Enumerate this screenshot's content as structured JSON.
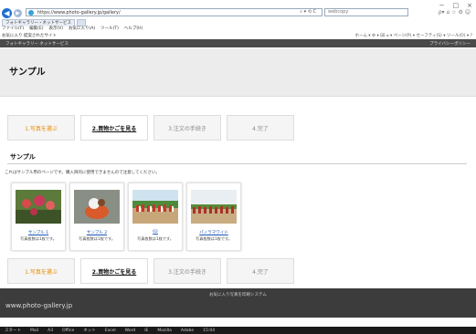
{
  "window": {
    "controls": [
      "−",
      "□",
      "×"
    ]
  },
  "browser": {
    "url": "https://www.photo-gallery.jp/gallery/",
    "url_tail": "⌕ ▾ ⟲ C",
    "search_placeholder": "webcopy",
    "right_icons": "ρ▾ ⌂ ☆ ⚙ ☺",
    "tab_label": "フォトギャラリー・ネットサービス",
    "menu": [
      "ファイル(F)",
      "編集(E)",
      "表示(V)",
      "お気に入り(A)",
      "ツール(T)",
      "ヘルプ(H)"
    ],
    "favorites_left": "お気に入り 提案されたサイト",
    "favorites_right": "ホーム ▾ ⚙ ▾ ⌧ ⌂ ▾ ページ(P) ▾ セーフティ(S) ▾ ツール(O) ▾ ?"
  },
  "site_header": {
    "left": "フォトギャラリー ネットサービス",
    "right": "プライバシーポリシー"
  },
  "page_title": "サンプル",
  "steps": [
    "1.写真を選ぶ",
    "2.買物かごを見る",
    "3.注文の手続き",
    "4.完了"
  ],
  "section_title": "サンプル",
  "note": "これはサンプル用のページです。購入目的に使用できませんので注意してください。",
  "gallery": [
    {
      "caption": "サンプル 1",
      "sub": "写真枚数は1枚です。",
      "scene": "flowers"
    },
    {
      "caption": "サンプル 2",
      "sub": "写真枚数は1枚です。",
      "scene": "dog"
    },
    {
      "caption": "02",
      "sub": "写真枚数は1枚です。",
      "scene": "crowd"
    },
    {
      "caption": "パノラマワイド",
      "sub": "写真枚数は1枚です。",
      "scene": "crowd2"
    }
  ],
  "footer": {
    "copyright": "お気に入り写真を印刷システム",
    "site": "www.photo-gallery.jp"
  },
  "taskbar": [
    "スタート",
    "Mail",
    "A3",
    "Office",
    "ネット",
    "Excel",
    "Word",
    "IE",
    "Mozilla",
    "Adobe",
    "15:04"
  ]
}
